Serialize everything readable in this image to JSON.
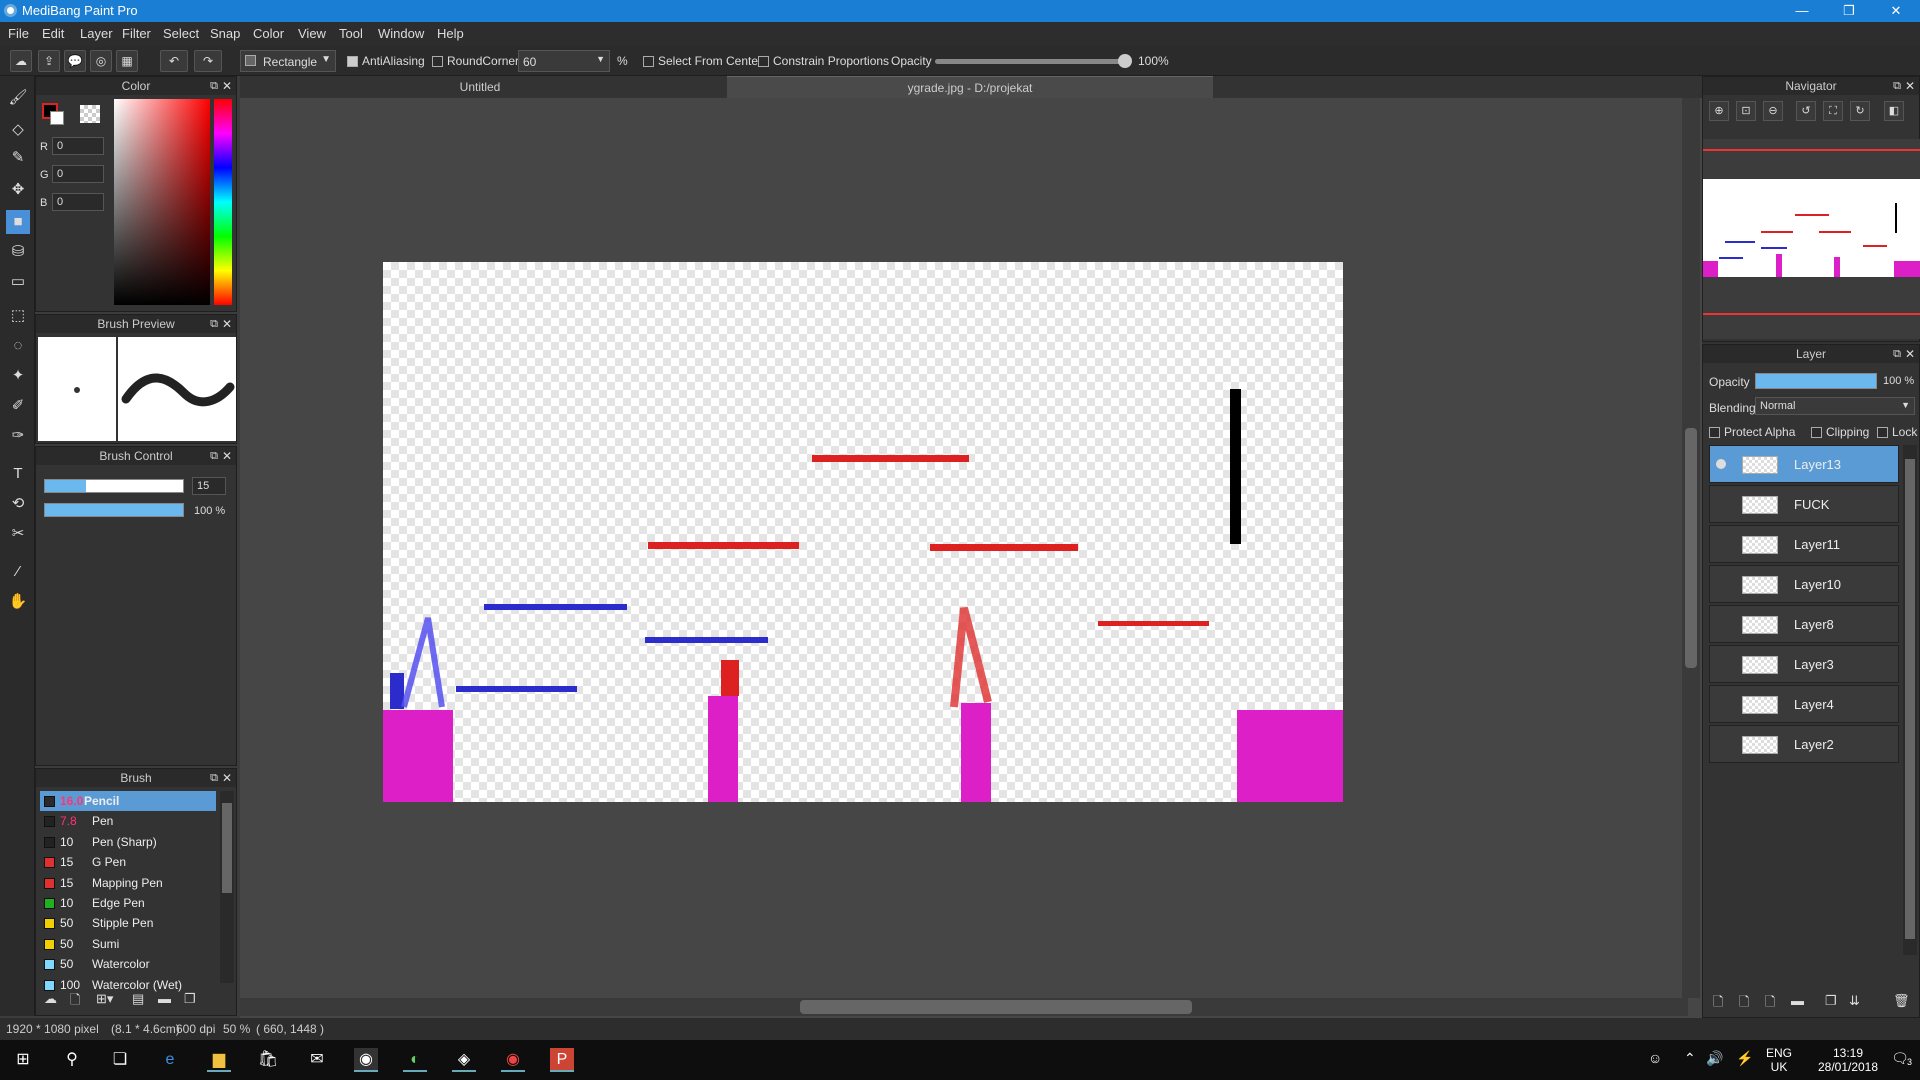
{
  "window": {
    "title": "MediBang Paint Pro",
    "minimize": "—",
    "restore": "❐",
    "close": "✕"
  },
  "menu": [
    "File",
    "Edit",
    "Layer",
    "Filter",
    "Select",
    "Snap",
    "Color",
    "View",
    "Tool",
    "Window",
    "Help"
  ],
  "toolbar": {
    "shape": "Rectangle",
    "antialiasing": "AntiAliasing",
    "roundcorner": "RoundCorner",
    "roundcorner_value": "60",
    "percent": "%",
    "select_from_center": "Select From Center",
    "constrain": "Constrain Proportions",
    "opacity_label": "Opacity",
    "opacity_value": "100%",
    "opacity_fraction": 1.0
  },
  "color_panel": {
    "title": "Color",
    "r_label": "R",
    "r": "0",
    "g_label": "G",
    "g": "0",
    "b_label": "B",
    "b": "0",
    "fg": "#000000",
    "bg": "#ffffff"
  },
  "brush_preview": {
    "title": "Brush Preview"
  },
  "brush_control": {
    "title": "Brush Control",
    "size": "15",
    "opacity": "100 %",
    "size_fraction": 0.3,
    "opacity_fraction": 1.0
  },
  "brush_panel": {
    "title": "Brush",
    "items": [
      {
        "size": "16.0",
        "name": "Pencil",
        "color": "#4a90d9",
        "selected": true
      },
      {
        "size": "7.8",
        "name": "Pen",
        "color": "#222222"
      },
      {
        "size": "10",
        "name": "Pen (Sharp)",
        "color": "#222222"
      },
      {
        "size": "15",
        "name": "G Pen",
        "color": "#e03030"
      },
      {
        "size": "15",
        "name": "Mapping Pen",
        "color": "#e03030"
      },
      {
        "size": "10",
        "name": "Edge Pen",
        "color": "#20b020"
      },
      {
        "size": "50",
        "name": "Stipple Pen",
        "color": "#f0d000"
      },
      {
        "size": "50",
        "name": "Sumi",
        "color": "#f0d000"
      },
      {
        "size": "50",
        "name": "Watercolor",
        "color": "#80d8ff"
      },
      {
        "size": "100",
        "name": "Watercolor (Wet)",
        "color": "#80d8ff"
      }
    ]
  },
  "tabs": [
    {
      "label": "Untitled"
    },
    {
      "label": "ygrade.jpg - D:/projekat"
    }
  ],
  "navigator": {
    "title": "Navigator"
  },
  "layer_panel": {
    "title": "Layer",
    "opacity_label": "Opacity",
    "opacity_value": "100 %",
    "blending_label": "Blending",
    "blending_value": "Normal",
    "protect_alpha": "Protect Alpha",
    "clipping": "Clipping",
    "lock": "Lock",
    "layers": [
      {
        "name": "Layer13",
        "selected": true
      },
      {
        "name": "FUCK"
      },
      {
        "name": "Layer11"
      },
      {
        "name": "Layer10"
      },
      {
        "name": "Layer8"
      },
      {
        "name": "Layer3"
      },
      {
        "name": "Layer4"
      },
      {
        "name": "Layer2"
      }
    ]
  },
  "status": {
    "size": "1920 * 1080 pixel",
    "cm": "(8.1 * 4.6cm)",
    "dpi": "600 dpi",
    "zoom": "50 %",
    "coords": "( 660, 1448 )"
  },
  "taskbar": {
    "lang": "ENG",
    "region": "UK",
    "time": "13:19",
    "date": "28/01/2018",
    "notifications": "3"
  },
  "colors": {
    "red": "#dd2020",
    "blue": "#2c2ccc",
    "magenta": "#dd1fc8",
    "black": "#000000"
  }
}
